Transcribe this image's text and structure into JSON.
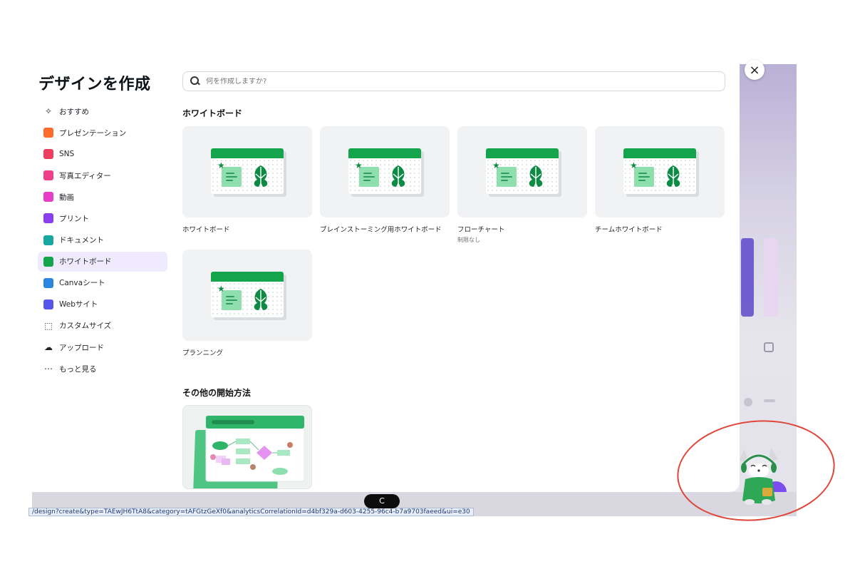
{
  "modal": {
    "title": "デザインを作成",
    "close_label": "×"
  },
  "search": {
    "placeholder": "何を作成しますか?"
  },
  "sidebar": {
    "items": [
      {
        "label": "おすすめ",
        "icon": "sparkle-icon",
        "color": "#1f2328"
      },
      {
        "label": "プレゼンテーション",
        "icon": "presentation-icon",
        "color": "#ff6b2c"
      },
      {
        "label": "SNS",
        "icon": "heart-icon",
        "color": "#ef3e5c"
      },
      {
        "label": "写真エディター",
        "icon": "camera-icon",
        "color": "#f03e8a"
      },
      {
        "label": "動画",
        "icon": "video-icon",
        "color": "#e63ec6"
      },
      {
        "label": "プリント",
        "icon": "printer-icon",
        "color": "#8b3ef0"
      },
      {
        "label": "ドキュメント",
        "icon": "document-icon",
        "color": "#18a6a0"
      },
      {
        "label": "ホワイトボード",
        "icon": "whiteboard-icon",
        "color": "#13a44c"
      },
      {
        "label": "Canvaシート",
        "icon": "sheet-icon",
        "color": "#2a86e0"
      },
      {
        "label": "Webサイト",
        "icon": "website-icon",
        "color": "#5856e8"
      },
      {
        "label": "カスタムサイズ",
        "icon": "custom-size-icon",
        "color": "#1f2328"
      },
      {
        "label": "アップロード",
        "icon": "upload-cloud-icon",
        "color": "#1f2328"
      },
      {
        "label": "もっと見る",
        "icon": "more-icon",
        "color": "#1f2328"
      }
    ],
    "active_index": 7
  },
  "sections": {
    "whiteboard": {
      "title": "ホワイトボード",
      "cards": [
        {
          "name": "ホワイトボード",
          "sub": ""
        },
        {
          "name": "ブレインストーミング用ホワイトボード",
          "sub": ""
        },
        {
          "name": "フローチャート",
          "sub": "制限なし"
        },
        {
          "name": "チームホワイトボード",
          "sub": ""
        },
        {
          "name": "プランニング",
          "sub": ""
        }
      ]
    },
    "other": {
      "title": "その他の開始方法"
    }
  },
  "status": {
    "url": "/design?create&type=TAEwJH6TtA8&category=tAFGtzGeXf0&analyticsCorrelationId=d4bf329a-d603-4255-96c4-b7a9703faeed&ui=e30",
    "loader": "C"
  },
  "colors": {
    "accent": "#13a44c",
    "active_bg": "#efeafe"
  }
}
